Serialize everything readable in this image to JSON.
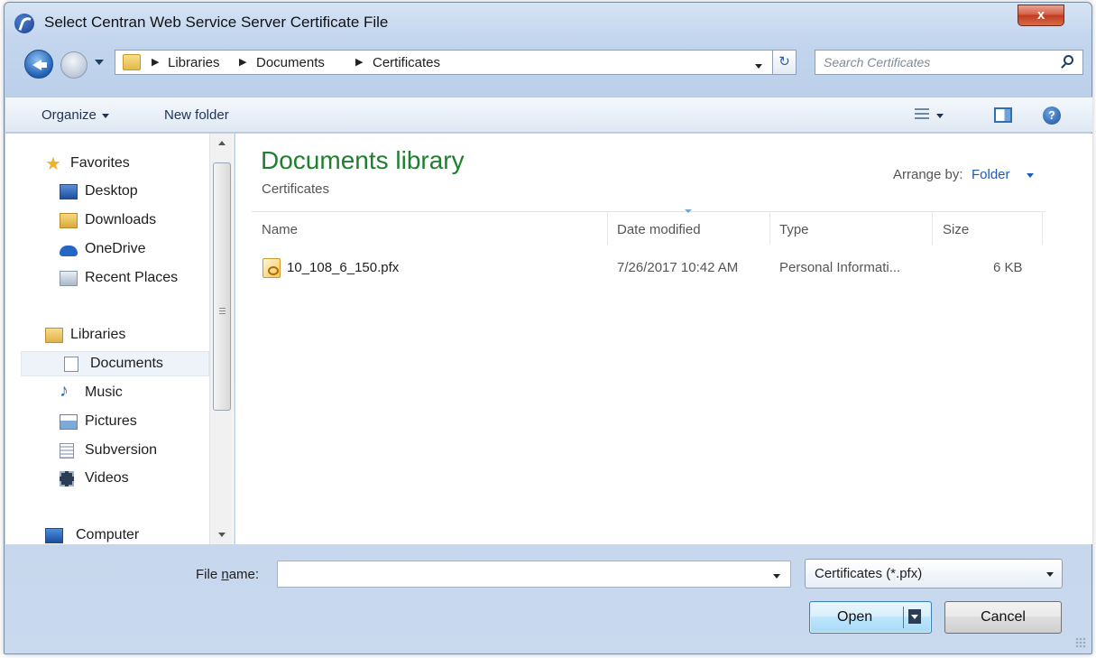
{
  "window": {
    "title": "Select Centran Web Service Server Certificate File",
    "close_label": "x"
  },
  "address": {
    "breadcrumbs": [
      "Libraries",
      "Documents",
      "Certificates"
    ],
    "search_placeholder": "Search Certificates"
  },
  "toolbar": {
    "organize": "Organize",
    "new_folder": "New folder",
    "help": "?"
  },
  "nav": {
    "favorites": [
      "Favorites",
      "Desktop",
      "Downloads",
      "OneDrive",
      "Recent Places"
    ],
    "libraries": [
      "Libraries",
      "Documents",
      "Music",
      "Pictures",
      "Subversion",
      "Videos"
    ],
    "computer": "Computer"
  },
  "content": {
    "library_title": "Documents library",
    "library_subtitle": "Certificates",
    "arrange_label": "Arrange by:",
    "arrange_value": "Folder",
    "columns": [
      "Name",
      "Date modified",
      "Type",
      "Size"
    ],
    "files": [
      {
        "name": "10_108_6_150.pfx",
        "date_modified": "7/26/2017 10:42 AM",
        "type": "Personal Informati...",
        "size": "6 KB"
      }
    ]
  },
  "footer": {
    "filename_label_pre": "File ",
    "filename_label_accel": "n",
    "filename_label_post": "ame:",
    "filename_value": "",
    "filetype": "Certificates (*.pfx)",
    "open_label": "Open",
    "cancel_label": "Cancel"
  },
  "colors": {
    "library_title": "#1e7f2e",
    "link_blue": "#1a5bbd",
    "close_red": "#c23a1f"
  }
}
